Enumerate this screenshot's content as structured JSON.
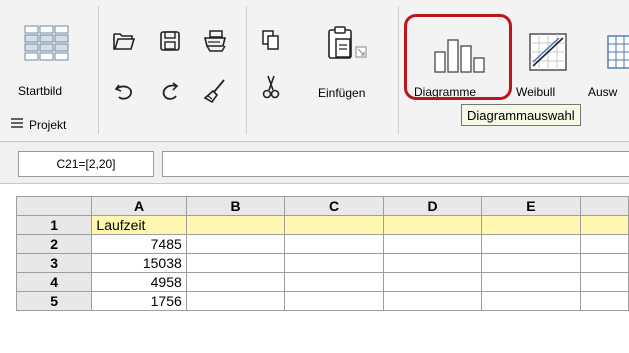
{
  "ribbon": {
    "buttons": [
      {
        "name": "startbild-button",
        "label": "Startbild",
        "icon": "grid-layout-icon"
      },
      {
        "name": "open-button",
        "label": "",
        "icon": "folder-open-icon"
      },
      {
        "name": "save-button",
        "label": "",
        "icon": "floppy-disk-icon"
      },
      {
        "name": "print-button",
        "label": "",
        "icon": "printer-icon"
      },
      {
        "name": "undo-button",
        "label": "",
        "icon": "undo-arrow-icon"
      },
      {
        "name": "redo-button",
        "label": "",
        "icon": "redo-arrow-icon"
      },
      {
        "name": "format-paint-button",
        "label": "",
        "icon": "paint-brush-icon"
      },
      {
        "name": "copy-button",
        "label": "",
        "icon": "copy-icon"
      },
      {
        "name": "cut-button",
        "label": "",
        "icon": "scissors-icon"
      },
      {
        "name": "einfuegen-button",
        "label": "Einfügen",
        "icon": "paste-clipboard-icon"
      },
      {
        "name": "diagramme-button",
        "label": "Diagramme",
        "icon": "bar-chart-icon"
      },
      {
        "name": "weibull-button",
        "label": "Weibull",
        "icon": "weibull-plot-icon"
      },
      {
        "name": "auswertung-button",
        "label": "Ausw",
        "icon": "table-grid-icon"
      }
    ],
    "projekt_label": "Projekt",
    "tooltip": "Diagrammauswahl",
    "highlight_color": "#b9151b"
  },
  "formula_bar": {
    "cell_reference": "C21=[2,20]",
    "value": ""
  },
  "grid": {
    "columns": [
      "A",
      "B",
      "C",
      "D",
      "E"
    ],
    "rows": [
      {
        "num": "1",
        "A": "Laufzeit"
      },
      {
        "num": "2",
        "A": "7485"
      },
      {
        "num": "3",
        "A": "15038"
      },
      {
        "num": "4",
        "A": "4958"
      },
      {
        "num": "5",
        "A": "1756"
      }
    ],
    "header_row_color": "#fff6b0"
  }
}
